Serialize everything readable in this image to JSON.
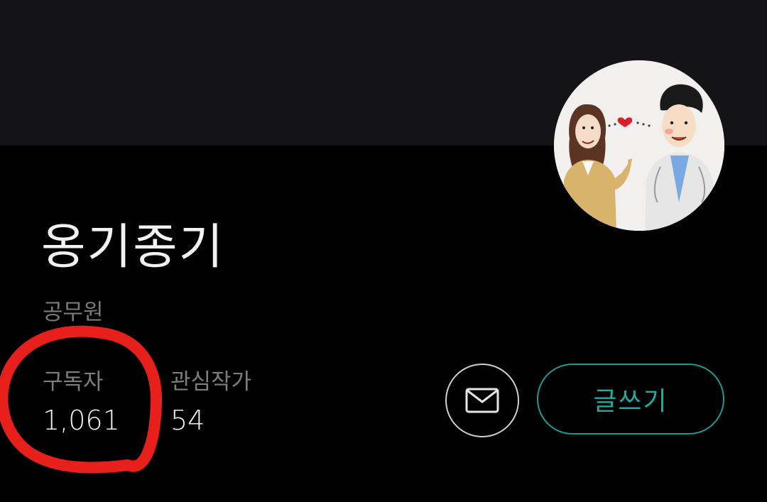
{
  "profile": {
    "name": "옹기종기",
    "job": "공무원"
  },
  "stats": {
    "subscribers_label": "구독자",
    "subscribers_value": "1,061",
    "following_label": "관심작가",
    "following_value": "54"
  },
  "actions": {
    "mail_icon": "envelope-icon",
    "write_label": "글쓰기"
  },
  "colors": {
    "accent": "#22a9a2",
    "annotation": "#e8201c"
  }
}
